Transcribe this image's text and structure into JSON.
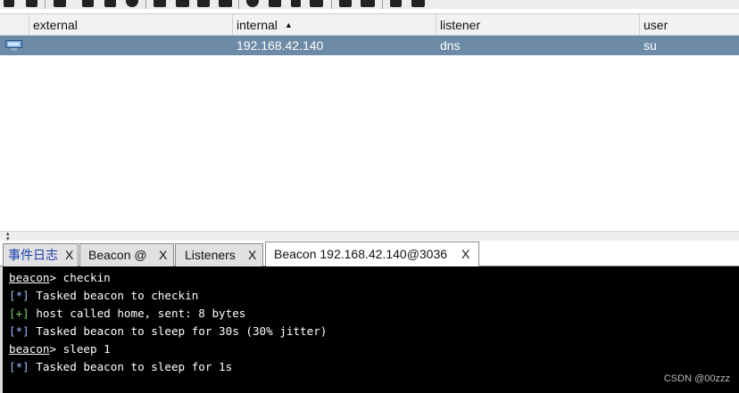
{
  "toolbar": {
    "icons": [
      "connect-icon",
      "disconnect-icon",
      "pivot-graph-icon",
      "sessions-icon",
      "listeners-icon",
      "targets-icon",
      "screenshots-icon",
      "downloads-icon",
      "credentials-icon",
      "image-icon",
      "settings-icon",
      "coffee-icon",
      "notes-icon",
      "terminal-icon",
      "link-icon",
      "cloud-icon",
      "book-icon",
      "help-icon"
    ]
  },
  "table": {
    "columns": [
      "",
      "external",
      "internal",
      "listener",
      "user"
    ],
    "sort_column": "internal",
    "rows": [
      {
        "external": "",
        "internal": "192.168.42.140",
        "listener": "dns",
        "user": "su"
      }
    ]
  },
  "tabs": [
    {
      "label": "事件日志",
      "close": "X",
      "active": false
    },
    {
      "label": "Beacon @",
      "close": "X",
      "active": false
    },
    {
      "label": "Listeners",
      "close": "X",
      "active": false
    },
    {
      "label": "Beacon 192.168.42.140@3036",
      "close": "X",
      "active": true
    }
  ],
  "console": {
    "lines": [
      {
        "prompt": "beacon",
        "text": "> checkin"
      },
      {
        "tag": "[*]",
        "text": " Tasked beacon to checkin"
      },
      {
        "tag": "[+]",
        "text": " host called home, sent: 8 bytes"
      },
      {
        "tag": "[*]",
        "text": " Tasked beacon to sleep for 30s (30% jitter)"
      },
      {
        "prompt": "beacon",
        "text": "> sleep 1"
      },
      {
        "tag": "[*]",
        "text": " Tasked beacon to sleep for 1s"
      }
    ]
  },
  "watermark": "CSDN @00zzz",
  "colors": {
    "selected_row": "#6d8aa6",
    "console_bg": "#000000",
    "info_tag": "#a0b8ff",
    "success_tag": "#7cd36a"
  }
}
